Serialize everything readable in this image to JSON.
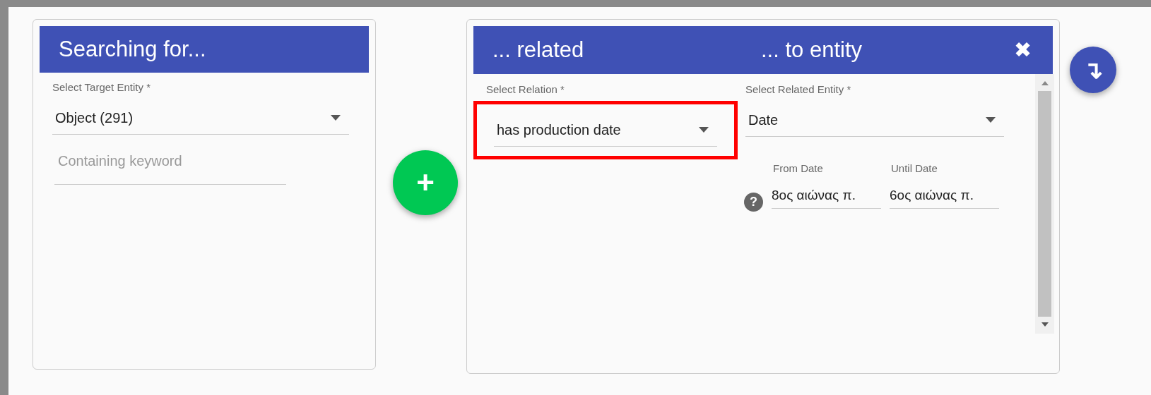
{
  "search_card": {
    "title": "Searching for...",
    "target_select": {
      "label": "Select Target Entity *",
      "value": "Object (291)"
    },
    "keyword_field": {
      "placeholder": "Containing keyword"
    }
  },
  "add_button": {
    "label": "+"
  },
  "relation_card": {
    "title_relation": "... related",
    "title_entity": "... to entity",
    "close": "✖",
    "relation_select": {
      "label": "Select Relation *",
      "value": "has production date",
      "highlighted": true
    },
    "entity_select": {
      "label": "Select Related Entity *",
      "value": "Date"
    },
    "help": "?",
    "date_fields": [
      {
        "label": "From Date",
        "value": "8ος αιώνας π."
      },
      {
        "label": "Until Date",
        "value": "6ος αιώνας π."
      }
    ]
  },
  "collapse_button": {
    "label": "↴"
  }
}
